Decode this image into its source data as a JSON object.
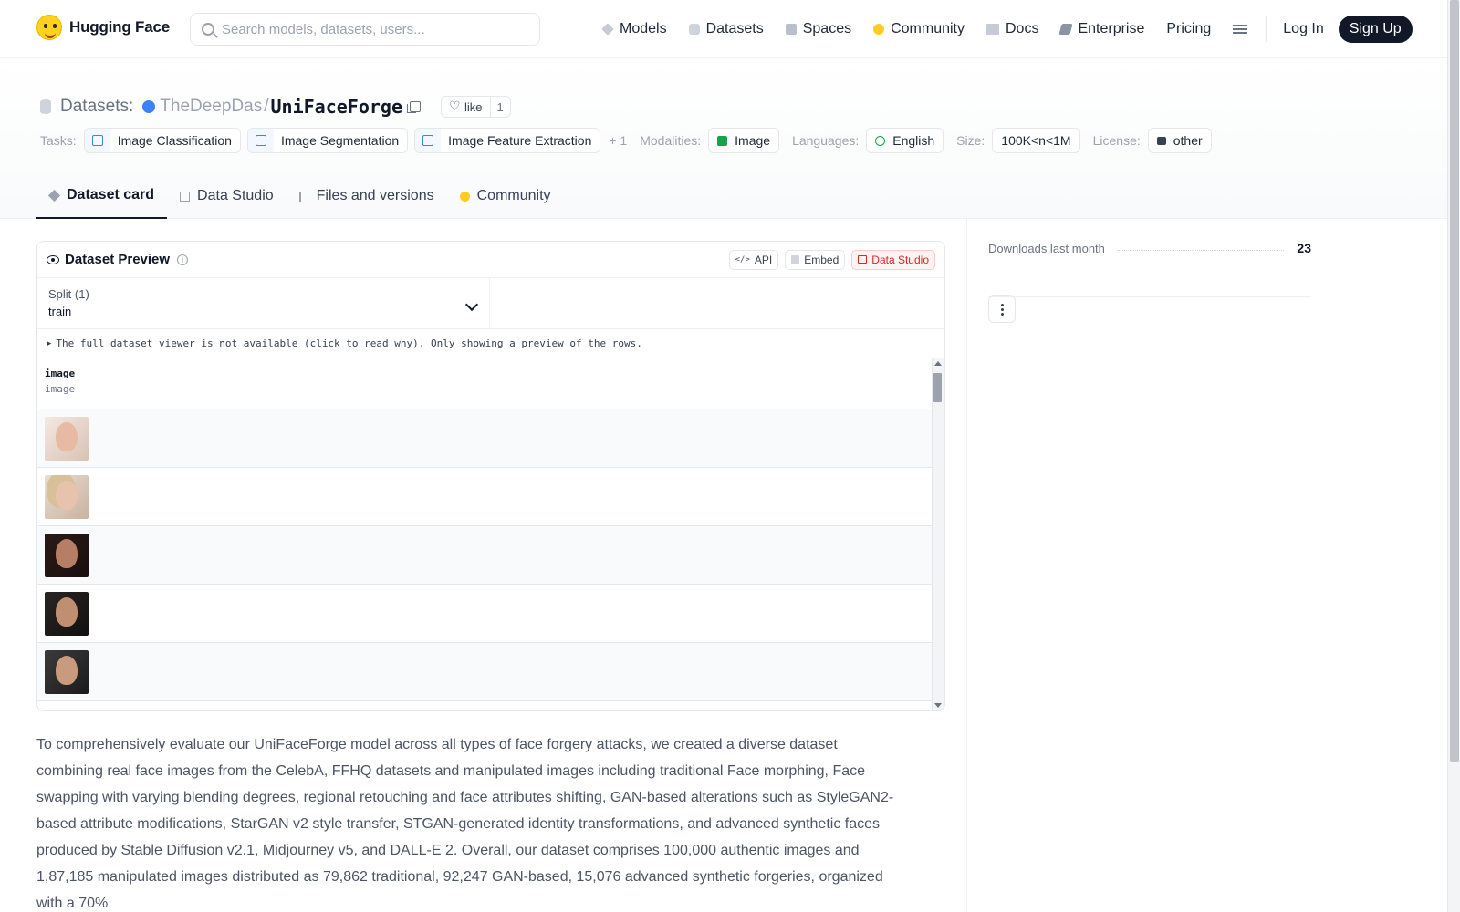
{
  "header": {
    "brand": "Hugging Face",
    "search_placeholder": "Search models, datasets, users...",
    "nav": [
      {
        "label": "Models",
        "icon": "models-icon"
      },
      {
        "label": "Datasets",
        "icon": "datasets-icon"
      },
      {
        "label": "Spaces",
        "icon": "spaces-icon"
      },
      {
        "label": "Community",
        "icon": "community-icon"
      },
      {
        "label": "Docs",
        "icon": "docs-icon"
      },
      {
        "label": "Enterprise",
        "icon": "enterprise-icon"
      },
      {
        "label": "Pricing"
      }
    ],
    "login": "Log In",
    "signup": "Sign Up"
  },
  "dataset": {
    "breadcrumb_label": "Datasets:",
    "owner": "TheDeepDas",
    "separator": "/",
    "name": "UniFaceForge",
    "like_label": "like",
    "like_count": "1",
    "tasks_label": "Tasks:",
    "tasks": [
      "Image Classification",
      "Image Segmentation",
      "Image Feature Extraction"
    ],
    "tasks_more": "+ 1",
    "modalities_label": "Modalities:",
    "modality": "Image",
    "languages_label": "Languages:",
    "language": "English",
    "size_label": "Size:",
    "size": "100K<n<1M",
    "license_label": "License:",
    "license": "other"
  },
  "tabs": [
    {
      "label": "Dataset card",
      "active": true
    },
    {
      "label": "Data Studio"
    },
    {
      "label": "Files and versions"
    },
    {
      "label": "Community"
    }
  ],
  "preview": {
    "title": "Dataset Preview",
    "info": "i",
    "api_label": "API",
    "api_icon_text": "</>",
    "embed_label": "Embed",
    "studio_label": "Data Studio",
    "split_label": "Split (1)",
    "split_value": "train",
    "notice": "The full dataset viewer is not available (click to read why). Only showing a preview of the rows.",
    "column_name": "image",
    "column_type": "image",
    "rows": 5
  },
  "description": "To comprehensively evaluate our UniFaceForge model across all types of face forgery attacks, we created a diverse dataset combining real face images from the CelebA, FFHQ datasets and manipulated images including traditional Face morphing, Face swapping with varying blending degrees, regional retouching and face attributes shifting, GAN-based alterations such as StyleGAN2-based attribute modifications, StarGAN v2 style transfer, STGAN-generated identity transformations, and advanced synthetic faces produced by Stable Diffusion v2.1, Midjourney v5, and DALL-E 2. Overall, our dataset comprises 100,000 authentic images and 1,87,185 manipulated images distributed as 79,862 traditional, 92,247 GAN-based, 15,076 advanced synthetic forgeries, organized with a 70%",
  "sidebar": {
    "downloads_label": "Downloads last month",
    "downloads_value": "23"
  },
  "colors": {
    "accent": "#111827",
    "brand_yellow": "#ffd21e",
    "owner_dot": "#3b82f6",
    "studio_red": "#dc2626"
  }
}
